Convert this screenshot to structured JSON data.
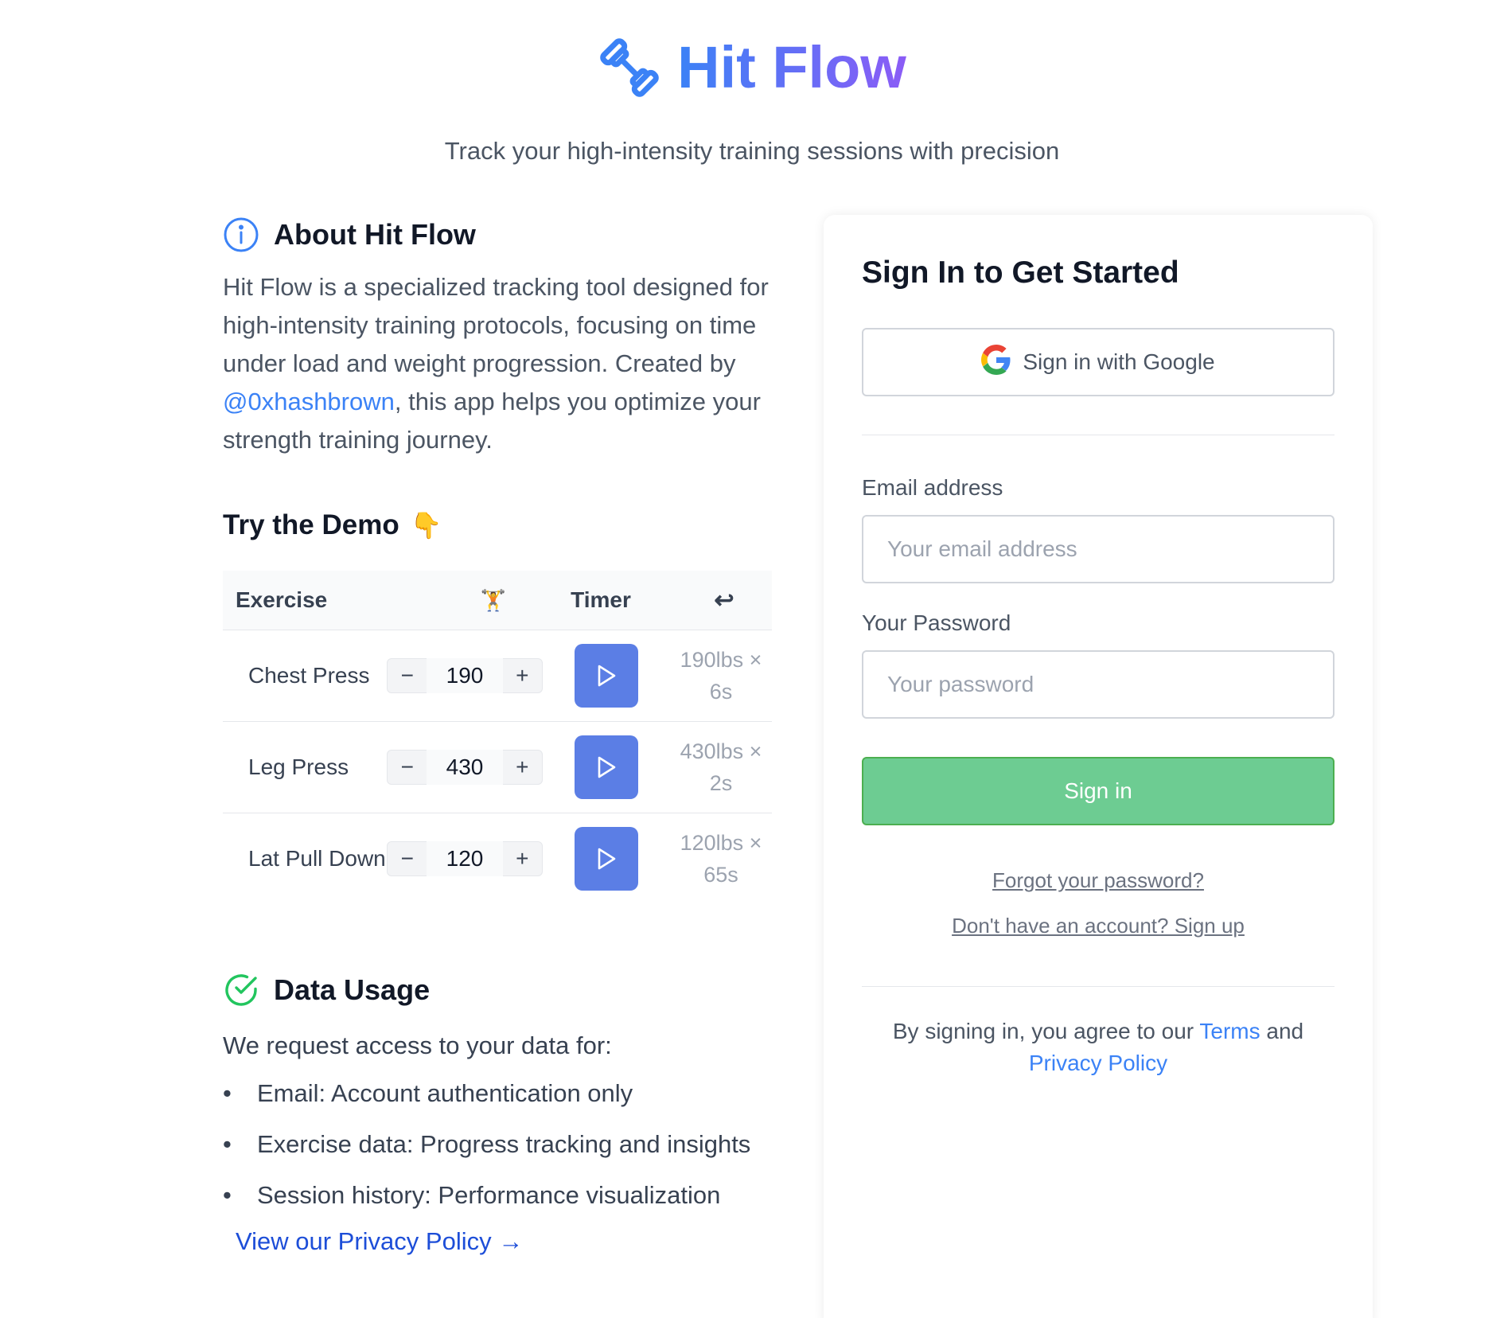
{
  "header": {
    "brand_icon": "dumbbell-icon",
    "title": "Hit Flow",
    "tagline": "Track your high-intensity training sessions with precision",
    "gradient": [
      "#3b82f6",
      "#8b5cf6"
    ]
  },
  "about": {
    "icon": "info-icon",
    "title": "About Hit Flow",
    "text_before": "Hit Flow is a specialized tracking tool designed for high-intensity training protocols, focusing on time under load and weight progression. Created by ",
    "creator_link": "@0xhashbrown",
    "text_after": ", this app helps you optimize your strength training journey."
  },
  "demo": {
    "title": "Try the Demo",
    "emoji": "👇",
    "columns": {
      "exercise": "Exercise",
      "weight_icon": "🏋",
      "timer": "Timer",
      "last_icon": "↩"
    },
    "rows": [
      {
        "name": "Chest Press",
        "weight": "190",
        "last": "190lbs × 6s"
      },
      {
        "name": "Leg Press",
        "weight": "430",
        "last": "430lbs × 2s"
      },
      {
        "name": "Lat Pull Down",
        "weight": "120",
        "last": "120lbs × 65s"
      }
    ],
    "minus": "−",
    "plus": "+",
    "play_icon": "play-icon",
    "play_color": "#5b7ee5"
  },
  "data_usage": {
    "icon": "check-circle-icon",
    "title": "Data Usage",
    "intro": "We request access to your data for:",
    "items": [
      "Email: Account authentication only",
      "Exercise data: Progress tracking and insights",
      "Session history: Performance visualization"
    ],
    "privacy_link": "View our Privacy Policy →"
  },
  "signin": {
    "title": "Sign In to Get Started",
    "google_label": "Sign in with Google",
    "email_label": "Email address",
    "email_placeholder": "Your email address",
    "email_value": "",
    "password_label": "Your Password",
    "password_placeholder": "Your password",
    "password_value": "",
    "submit_label": "Sign in",
    "submit_color": "#6dcc92",
    "forgot_link": "Forgot your password?",
    "signup_link": "Don't have an account? Sign up",
    "terms_before": "By signing in, you agree to our ",
    "terms_link": "Terms",
    "terms_mid": " and",
    "privacy_link": "Privacy Policy"
  }
}
